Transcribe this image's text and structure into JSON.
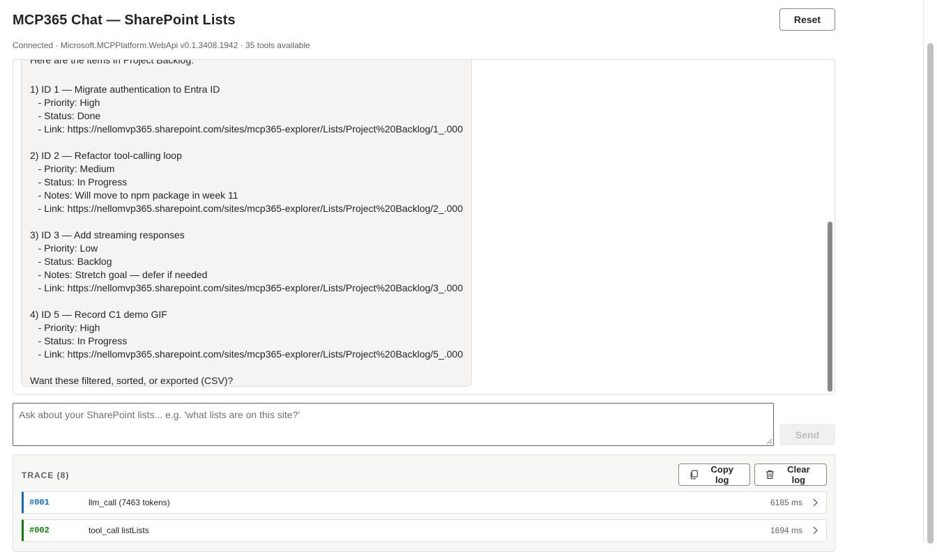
{
  "header": {
    "title": "MCP365 Chat — SharePoint Lists",
    "reset_label": "Reset",
    "status": "Connected · Microsoft.MCPPlatform.WebApi v0.1.3408.1942 · 35 tools available"
  },
  "chat": {
    "message_lines": [
      "Here are the items in Project Backlog:",
      "",
      "1) ID 1 — Migrate authentication to Entra ID",
      "   - Priority: High",
      "   - Status: Done",
      "   - Link: https://nellomvp365.sharepoint.com/sites/mcp365-explorer/Lists/Project%20Backlog/1_.000",
      "",
      "2) ID 2 — Refactor tool-calling loop",
      "   - Priority: Medium",
      "   - Status: In Progress",
      "   - Notes: Will move to npm package in week 11",
      "   - Link: https://nellomvp365.sharepoint.com/sites/mcp365-explorer/Lists/Project%20Backlog/2_.000",
      "",
      "3) ID 3 — Add streaming responses",
      "   - Priority: Low",
      "   - Status: Backlog",
      "   - Notes: Stretch goal — defer if needed",
      "   - Link: https://nellomvp365.sharepoint.com/sites/mcp365-explorer/Lists/Project%20Backlog/3_.000",
      "",
      "4) ID 5 — Record C1 demo GIF",
      "   - Priority: High",
      "   - Status: In Progress",
      "   - Link: https://nellomvp365.sharepoint.com/sites/mcp365-explorer/Lists/Project%20Backlog/5_.000",
      "",
      "Want these filtered, sorted, or exported (CSV)?"
    ]
  },
  "composer": {
    "placeholder": "Ask about your SharePoint lists... e.g. 'what lists are on this site?'",
    "value": "",
    "send_label": "Send"
  },
  "trace": {
    "heading": "TRACE (8)",
    "copy_label": "Copy log",
    "clear_label": "Clear log",
    "rows": [
      {
        "id": "#001",
        "label": "llm_call (7463 tokens)",
        "duration": "6185 ms",
        "kind": "llm"
      },
      {
        "id": "#002",
        "label": "tool_call listLists",
        "duration": "1694 ms",
        "kind": "tool"
      }
    ]
  },
  "colors": {
    "llm_accent": "#0f6cbd",
    "tool_accent": "#107c10"
  }
}
